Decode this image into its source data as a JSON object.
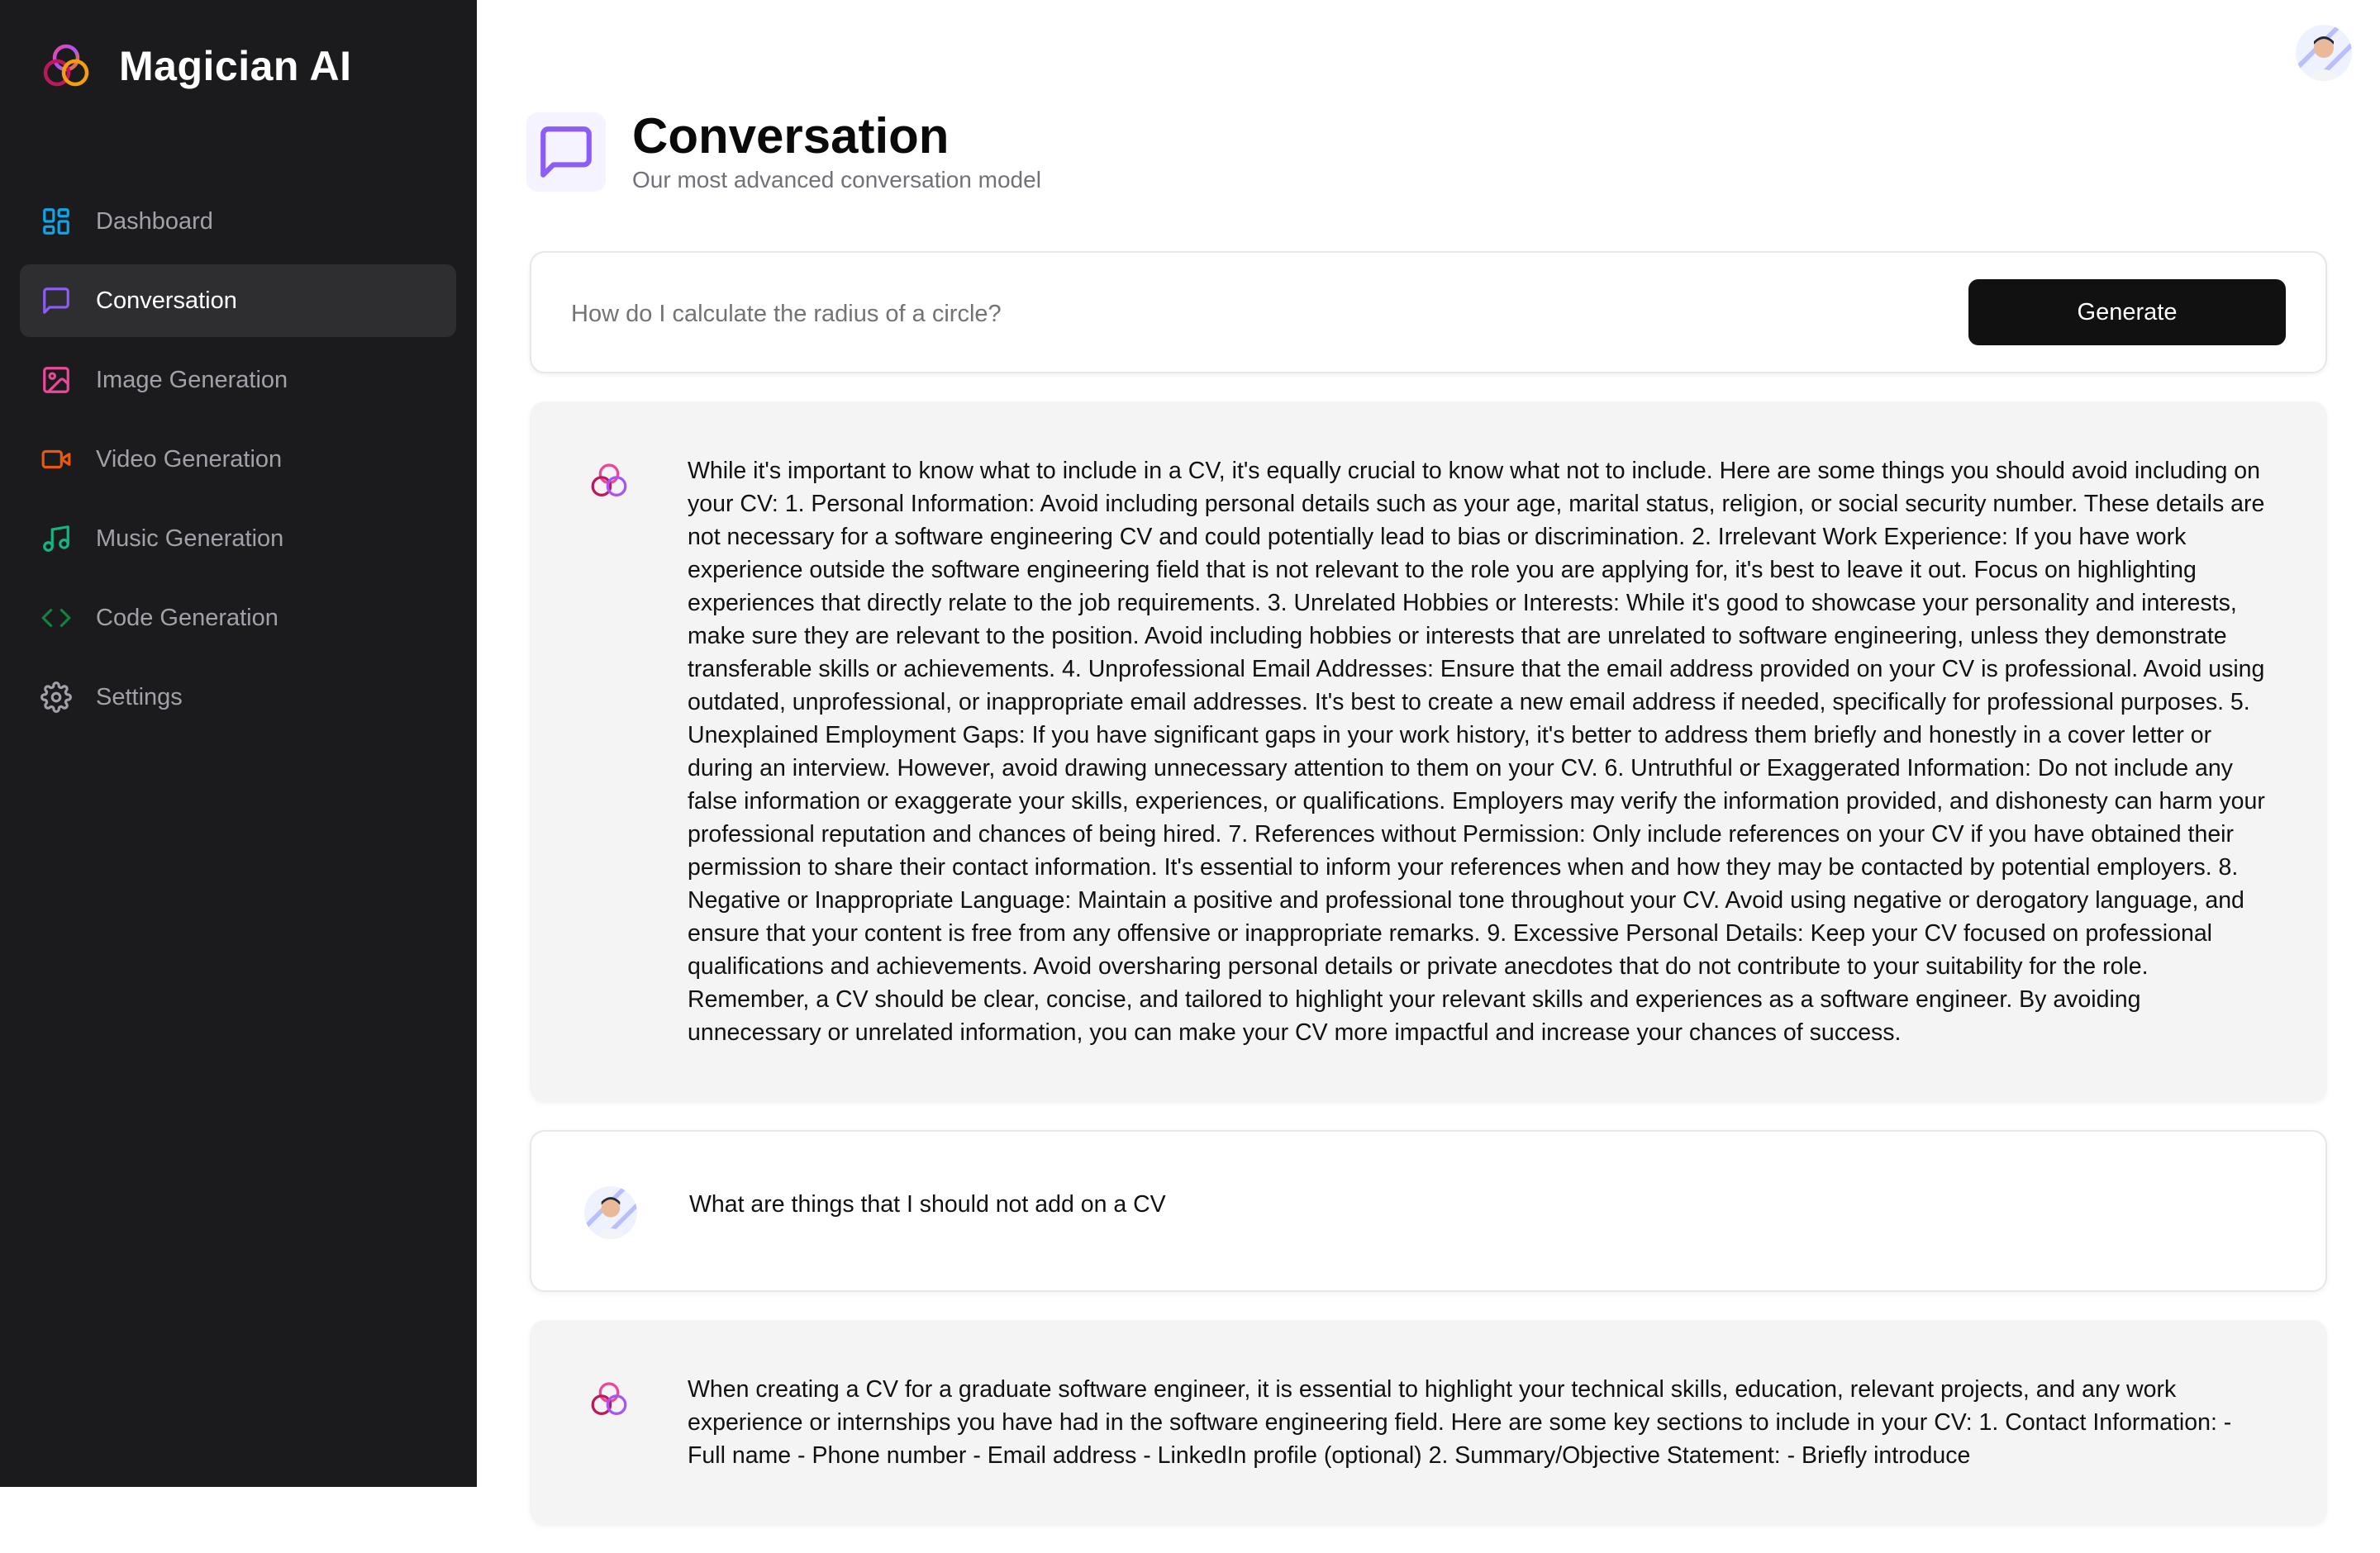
{
  "app": {
    "name": "Magician AI"
  },
  "colors": {
    "sidebar_bg": "#1b1b1d",
    "dashboard_icon": "#0ea5e9",
    "conversation_icon": "#8b5cf6",
    "image_icon": "#ec4899",
    "video_icon": "#ea580c",
    "music_icon": "#10b981",
    "code_icon": "#15803d",
    "settings_icon": "#a1a1aa"
  },
  "sidebar": {
    "items": [
      {
        "label": "Dashboard",
        "icon": "dashboard-icon"
      },
      {
        "label": "Conversation",
        "icon": "message-square-icon",
        "active": true
      },
      {
        "label": "Image Generation",
        "icon": "image-icon"
      },
      {
        "label": "Video Generation",
        "icon": "video-icon"
      },
      {
        "label": "Music Generation",
        "icon": "music-icon"
      },
      {
        "label": "Code Generation",
        "icon": "code-icon"
      },
      {
        "label": "Settings",
        "icon": "gear-icon"
      }
    ]
  },
  "header": {
    "title": "Conversation",
    "subtitle": "Our most advanced conversation model"
  },
  "prompt": {
    "placeholder": "How do I calculate the radius of a circle?",
    "value": "",
    "button_label": "Generate"
  },
  "messages": [
    {
      "role": "assistant",
      "text": "While it's important to know what to include in a CV, it's equally crucial to know what not to include. Here are some things you should avoid including on your CV: 1. Personal Information: Avoid including personal details such as your age, marital status, religion, or social security number. These details are not necessary for a software engineering CV and could potentially lead to bias or discrimination. 2. Irrelevant Work Experience: If you have work experience outside the software engineering field that is not relevant to the role you are applying for, it's best to leave it out. Focus on highlighting experiences that directly relate to the job requirements. 3. Unrelated Hobbies or Interests: While it's good to showcase your personality and interests, make sure they are relevant to the position. Avoid including hobbies or interests that are unrelated to software engineering, unless they demonstrate transferable skills or achievements. 4. Unprofessional Email Addresses: Ensure that the email address provided on your CV is professional. Avoid using outdated, unprofessional, or inappropriate email addresses. It's best to create a new email address if needed, specifically for professional purposes. 5. Unexplained Employment Gaps: If you have significant gaps in your work history, it's better to address them briefly and honestly in a cover letter or during an interview. However, avoid drawing unnecessary attention to them on your CV. 6. Untruthful or Exaggerated Information: Do not include any false information or exaggerate your skills, experiences, or qualifications. Employers may verify the information provided, and dishonesty can harm your professional reputation and chances of being hired. 7. References without Permission: Only include references on your CV if you have obtained their permission to share their contact information. It's essential to inform your references when and how they may be contacted by potential employers. 8. Negative or Inappropriate Language: Maintain a positive and professional tone throughout your CV. Avoid using negative or derogatory language, and ensure that your content is free from any offensive or inappropriate remarks. 9. Excessive Personal Details: Keep your CV focused on professional qualifications and achievements. Avoid oversharing personal details or private anecdotes that do not contribute to your suitability for the role. Remember, a CV should be clear, concise, and tailored to highlight your relevant skills and experiences as a software engineer. By avoiding unnecessary or unrelated information, you can make your CV more impactful and increase your chances of success."
    },
    {
      "role": "user",
      "text": "What are things that I should not add on a CV"
    },
    {
      "role": "assistant",
      "text": "When creating a CV for a graduate software engineer, it is essential to highlight your technical skills, education, relevant projects, and any work experience or internships you have had in the software engineering field. Here are some key sections to include in your CV: 1. Contact Information: - Full name - Phone number - Email address - LinkedIn profile (optional) 2. Summary/Objective Statement: - Briefly introduce"
    }
  ]
}
